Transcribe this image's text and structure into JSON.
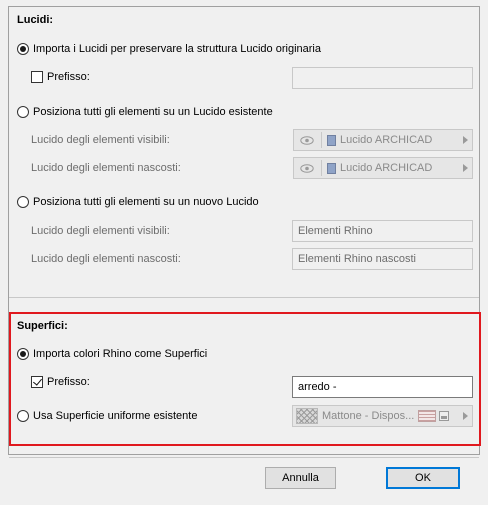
{
  "lucidi": {
    "heading": "Lucidi:",
    "option_import": "Importa i Lucidi per preservare la struttura Lucido originaria",
    "prefix_label": "Prefisso:",
    "prefix_value": "",
    "option_existing": "Posiziona tutti gli elementi su un Lucido esistente",
    "visible_label": "Lucido degli elementi visibili:",
    "visible_popup": "Lucido ARCHICAD",
    "hidden_label": "Lucido degli elementi nascosti:",
    "hidden_popup": "Lucido ARCHICAD",
    "option_new": "Posiziona tutti gli elementi su un nuovo Lucido",
    "new_visible_label": "Lucido degli elementi visibili:",
    "new_visible_value": "Elementi Rhino",
    "new_hidden_label": "Lucido degli elementi nascosti:",
    "new_hidden_value": "Elementi Rhino nascosti",
    "selected": "option_import",
    "prefix_checked": false
  },
  "superfici": {
    "heading": "Superfici:",
    "option_import_colors": "Importa colori Rhino come Superfici",
    "prefix_label": "Prefisso:",
    "prefix_value": "arredo -",
    "option_uniform": "Usa Superficie uniforme esistente",
    "surface_popup": "Mattone - Dispos...",
    "selected": "option_import_colors",
    "prefix_checked": true
  },
  "buttons": {
    "cancel": "Annulla",
    "ok": "OK"
  },
  "colors": {
    "highlight": "#e0181e",
    "default_button_border": "#0078d7"
  },
  "icons": [
    "eye-icon",
    "layer-icon",
    "arrow-right-icon",
    "surface-swatch-icon",
    "hatch-pattern-icon",
    "image-icon"
  ]
}
